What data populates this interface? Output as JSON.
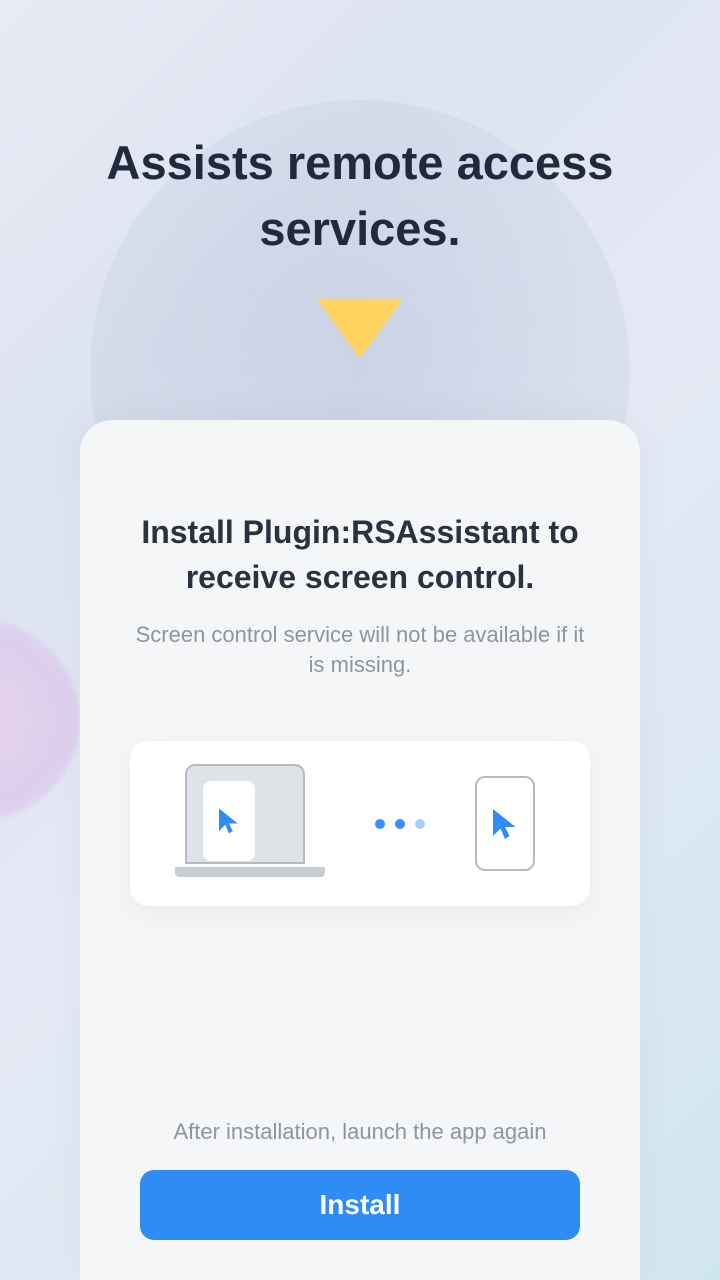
{
  "hero": {
    "title": "Assists remote access services."
  },
  "card": {
    "title": "Install Plugin:RSAssistant to receive screen control.",
    "subtitle": "Screen control service will not be available if it is missing.",
    "footer_text": "After installation, launch the app again",
    "install_label": "Install"
  },
  "colors": {
    "accent": "#2f8cf4",
    "triangle": "#ffd96b"
  }
}
